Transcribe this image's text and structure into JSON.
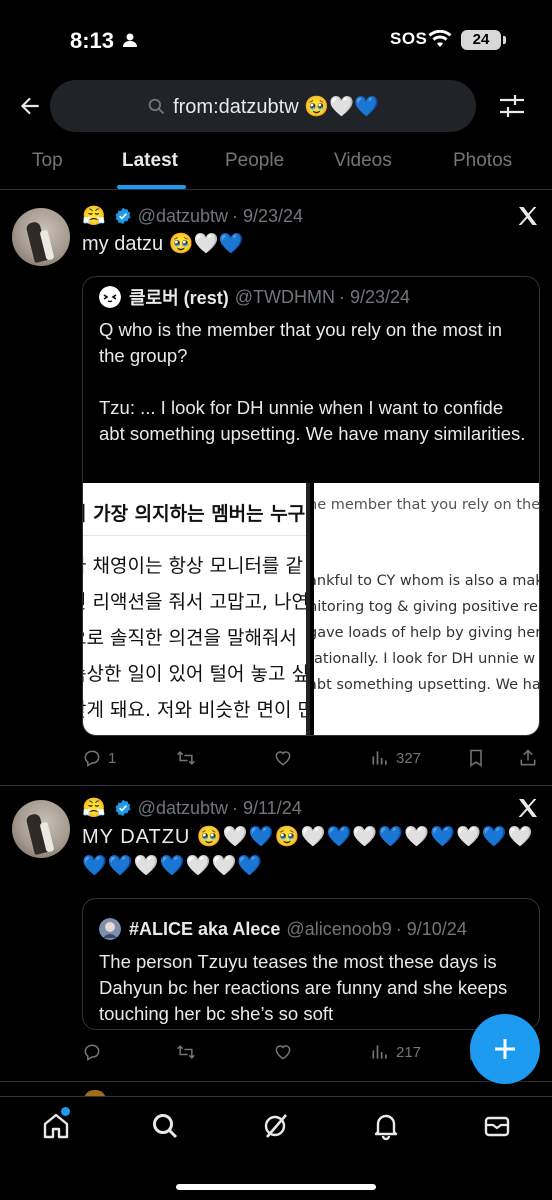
{
  "status_bar": {
    "time": "8:13",
    "sos": "SOS",
    "battery": "24"
  },
  "search": {
    "query": "from:datzubtw 🥹🤍💙"
  },
  "tabs": [
    {
      "label": "Top",
      "active": false
    },
    {
      "label": "Latest",
      "active": true
    },
    {
      "label": "People",
      "active": false
    },
    {
      "label": "Videos",
      "active": false
    },
    {
      "label": "Photos",
      "active": false
    }
  ],
  "posts": [
    {
      "emoji": "😤",
      "handle": "@datzubtw",
      "date": "· 9/23/24",
      "text": "my datzu 🥹🤍💙",
      "quote": {
        "name": "클로버 (rest)",
        "handle": "@TWDHMN",
        "date": "· 9/23/24",
        "text": "Q who is the member that you rely on the most in the group?\n\nTzu: ... I look for DH unnie when I want to confide abt something upsetting. We have many similarities.",
        "media_left_lines": [
          "서 가장 의지하는 멤버는 누구",
          "나 채영이는 항상 모니터를 같",
          "인 리액션을 줘서 고맙고, 나연",
          "으로 솔직한 의견을 말해줘서 ",
          "속상한 일이 있어 털어 놓고 싶을",
          "찾게 돼요. 저와 비슷한 면이 만"
        ],
        "media_right_lines": [
          "he member that you rely on the",
          "ankful to CY whom is also a mak",
          "nitoring tog & giving positive rea",
          "gave loads of help by giving her",
          "rationally. I look for DH unnie w",
          "abt something upsetting. We ha"
        ]
      },
      "replies": "1",
      "reposts": "",
      "likes": "",
      "views": "327"
    },
    {
      "emoji": "😤",
      "handle": "@datzubtw",
      "date": "· 9/11/24",
      "text": "MY DATZU 🥹🤍💙🥹🤍💙🤍💙🤍💙🤍💙🤍💙💙🤍💙🤍🤍💙",
      "quote": {
        "name": "#ALICE aka Alece",
        "handle": "@alicenoob9",
        "date": "· 9/10/24",
        "text": "The person Tzuyu teases the most these days is Dahyun bc her reactions are funny and she keeps touching her bc she’s so soft"
      },
      "replies": "",
      "reposts": "",
      "likes": "",
      "views": "217"
    }
  ],
  "colors": {
    "accent": "#1d9bf0",
    "background": "#000000",
    "muted": "#71767b"
  },
  "icons": [
    "back-arrow-icon",
    "search-icon",
    "filter-icon",
    "x-logo-icon",
    "reply-icon",
    "repost-icon",
    "like-icon",
    "views-icon",
    "bookmark-icon",
    "share-icon",
    "compose-icon",
    "home-icon",
    "explore-icon",
    "grok-icon",
    "notifications-icon",
    "messages-icon"
  ]
}
